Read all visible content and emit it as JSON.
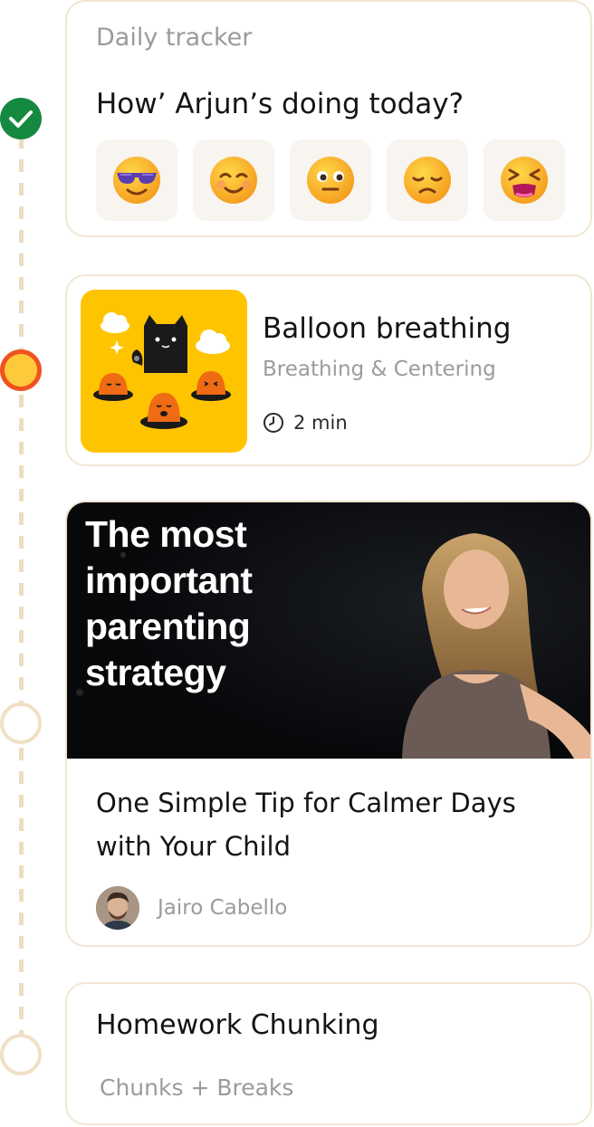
{
  "tracker": {
    "label": "Daily tracker",
    "question": "How’ Arjun’s doing today?",
    "moods": [
      "cool-face",
      "smiling-face",
      "neutral-face",
      "sad-face",
      "tired-face"
    ]
  },
  "activity": {
    "title": "Balloon breathing",
    "category": "Breathing & Centering",
    "duration": "2 min"
  },
  "video": {
    "thumbnail_text": "The most important parenting strategy",
    "title": "One Simple Tip for Calmer Days with Your Child",
    "author": "Jairo Cabello"
  },
  "homework": {
    "title": "Homework Chunking",
    "subtitle": "Chunks + Breaks"
  },
  "colors": {
    "done": "#15893f",
    "current_fill": "#ffc93c",
    "current_ring": "#f0531e",
    "upcoming_ring": "#f0e0c6",
    "card_border": "#f1e6d3",
    "thumb_yellow": "#ffc400"
  },
  "timeline": [
    "completed",
    "current",
    "upcoming",
    "upcoming"
  ]
}
